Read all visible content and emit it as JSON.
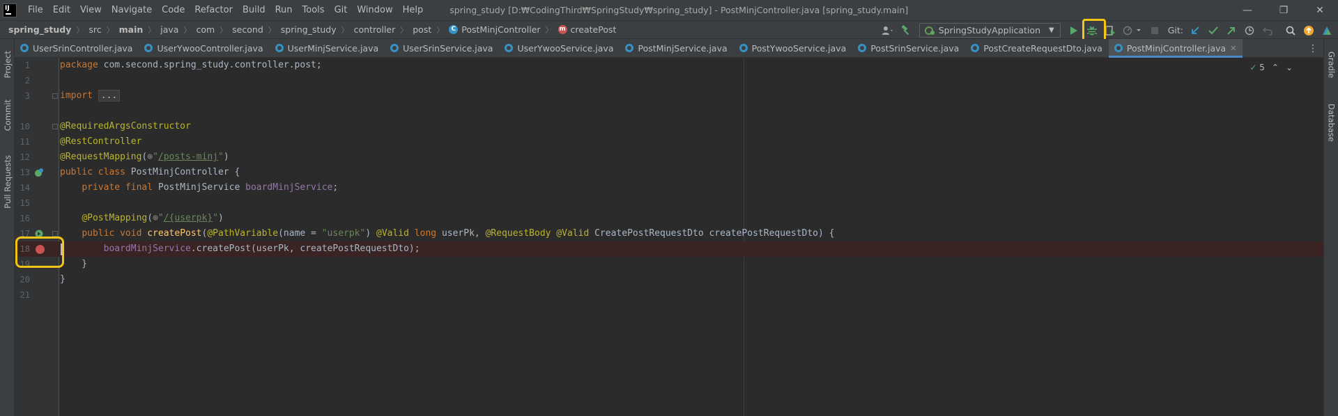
{
  "menubar": {
    "logo": "IJ",
    "items": [
      "File",
      "Edit",
      "View",
      "Navigate",
      "Code",
      "Refactor",
      "Build",
      "Run",
      "Tools",
      "Git",
      "Window",
      "Help"
    ],
    "title": "spring_study [D:₩CodingThird₩SpringStudy₩spring_study] - PostMinjController.java [spring_study.main]",
    "minimize": "—",
    "restore": "❐",
    "close": "✕"
  },
  "breadcrumb": {
    "items": [
      "spring_study",
      "src",
      "main",
      "java",
      "com",
      "second",
      "spring_study",
      "controller",
      "post",
      "PostMinjController",
      "createPost"
    ],
    "class_badge": "C",
    "method_badge": "m"
  },
  "toolbar": {
    "run_config": "SpringStudyApplication",
    "git_label": "Git:",
    "icons": [
      "user-icon",
      "build-hammer-icon",
      "run-icon",
      "debug-icon",
      "coverage-icon",
      "profile-icon",
      "stop-icon",
      "git-update-icon",
      "git-commit-icon",
      "git-push-icon",
      "history-icon",
      "rollback-icon",
      "search-icon",
      "update-icon",
      "plugin-icon"
    ],
    "accent": "#f2c415"
  },
  "left_tools": [
    "Project",
    "Commit",
    "Pull Requests"
  ],
  "right_tools": [
    "Gradle",
    "Database"
  ],
  "tabs": [
    "UserSrinController.java",
    "UserYwooController.java",
    "UserMinjService.java",
    "UserSrinService.java",
    "UserYwooService.java",
    "PostMinjService.java",
    "PostYwooService.java",
    "PostSrinService.java",
    "PostCreateRequestDto.java",
    "PostMinjController.java"
  ],
  "active_tab": "PostMinjController.java",
  "inspections": {
    "count": "5",
    "check": "✓"
  },
  "code_lines": [
    {
      "n": "1",
      "text": "package com.second.spring_study.controller.post;"
    },
    {
      "n": "2",
      "text": ""
    },
    {
      "n": "3",
      "text": "import ..."
    },
    {
      "n": "10",
      "text": "@RequiredArgsConstructor"
    },
    {
      "n": "11",
      "text": "@RestController"
    },
    {
      "n": "12",
      "text": "@RequestMapping(\"/posts-minj\")"
    },
    {
      "n": "13",
      "text": "public class PostMinjController {"
    },
    {
      "n": "14",
      "text": "    private final PostMinjService boardMinjService;"
    },
    {
      "n": "15",
      "text": ""
    },
    {
      "n": "16",
      "text": "    @PostMapping(\"/{userpk}\")"
    },
    {
      "n": "17",
      "text": "    public void createPost(@PathVariable(name = \"userpk\") @Valid long userPk, @RequestBody @Valid CreatePostRequestDto createPostRequestDto) {"
    },
    {
      "n": "18",
      "text": "        boardMinjService.createPost(userPk, createPostRequestDto);"
    },
    {
      "n": "19",
      "text": "    }"
    },
    {
      "n": "20",
      "text": "}"
    },
    {
      "n": "21",
      "text": ""
    }
  ],
  "breakpoint_line": "18"
}
